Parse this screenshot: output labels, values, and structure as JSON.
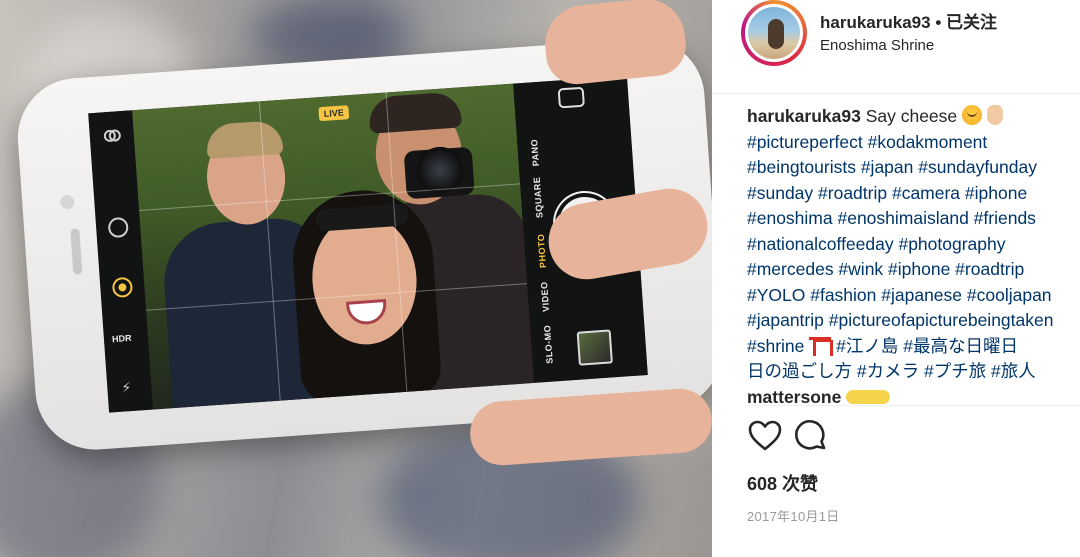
{
  "post": {
    "username": "harukaruka93",
    "follow_separator": "•",
    "follow_status": "已关注",
    "location": "Enoshima Shrine"
  },
  "caption": {
    "username": "harukaruka93",
    "text": "Say cheese",
    "lines": [
      "#pictureperfect #kodakmoment",
      "#beingtourists #japan #sundayfunday",
      "#sunday #roadtrip #camera #iphone",
      "#enoshima #enoshimaisland #friends",
      "#nationalcoffeeday #photography",
      "#mercedes #wink #iphone #roadtrip",
      "#YOLO #fashion #japanese #cooljapan",
      "#japantrip #pictureofapicturebeingtaken"
    ],
    "shrine_tag": "#shrine",
    "jp_line_a": "#江ノ島 #最高な日曜日",
    "jp_line_b": "日の過ごし方 #カメラ #プチ旅 #旅人",
    "partial_last": "mattersone"
  },
  "camera_ui": {
    "live_badge": "LIVE",
    "hdr_label": "HDR",
    "modes": [
      "PANO",
      "SQUARE",
      "PHOTO",
      "VIDEO",
      "SLO-MO"
    ],
    "active_mode": "PHOTO"
  },
  "engagement": {
    "likes_count": "608",
    "likes_label": "次赞",
    "date": "2017年10月1日"
  },
  "colors": {
    "hashtag": "#003569",
    "text": "#262626",
    "muted": "#999999",
    "live_yellow": "#f6c543"
  },
  "icons": [
    "heart-icon",
    "comment-icon",
    "flip-camera-icon",
    "timer-icon",
    "live-photo-icon",
    "flash-off-icon",
    "shutter-button"
  ]
}
